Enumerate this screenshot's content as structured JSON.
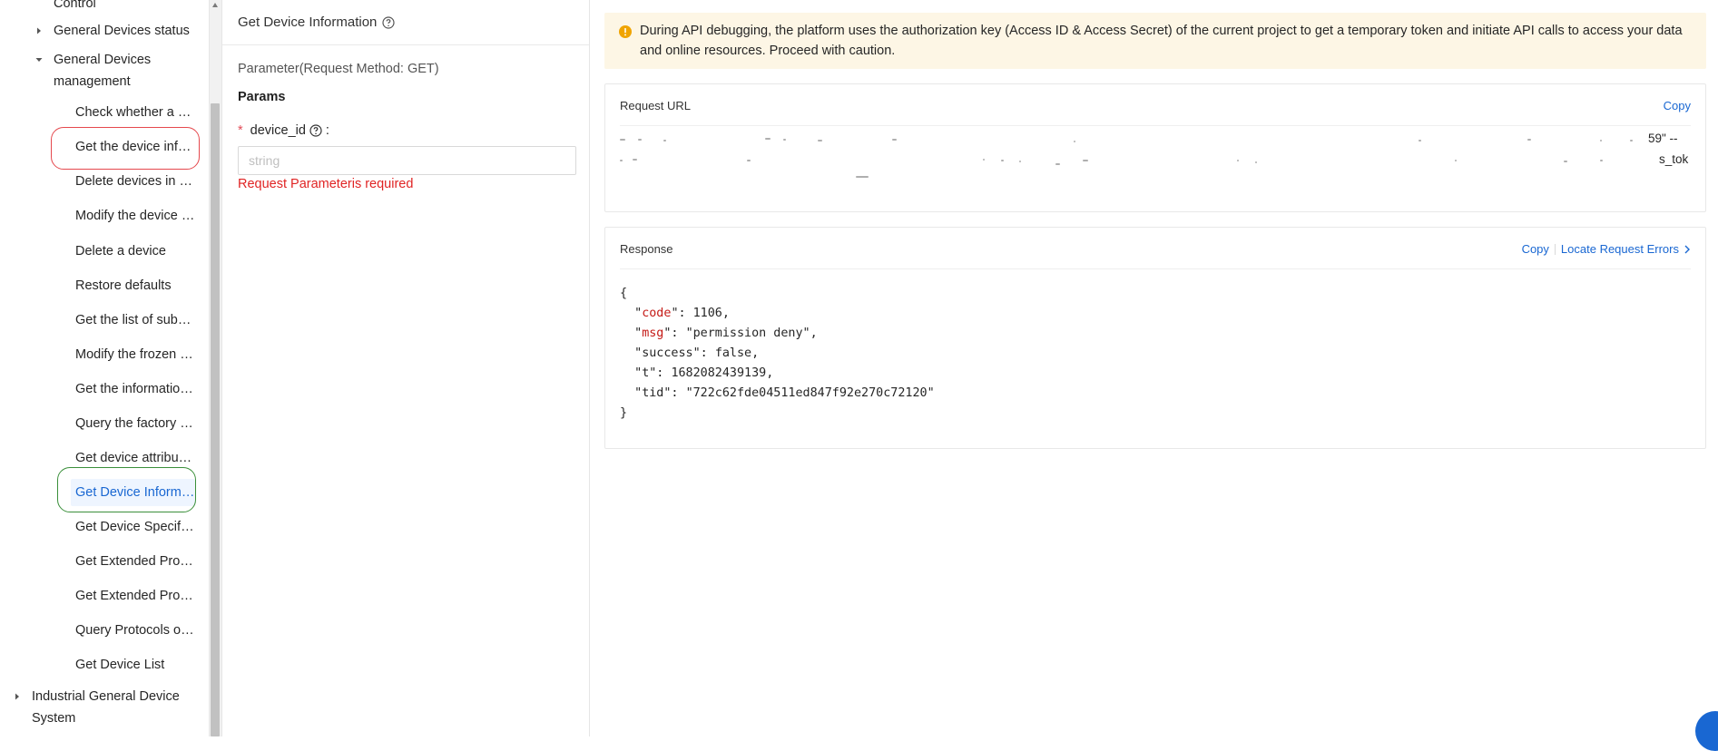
{
  "sidebar": {
    "top_partial_label": "Control",
    "groups": [
      {
        "label": "General Devices status",
        "expanded": false
      },
      {
        "label": "General Devices management",
        "expanded": true
      }
    ],
    "management_items": [
      {
        "label": "Check whether a device exists"
      },
      {
        "label": "Get the device information"
      },
      {
        "label": "Delete devices in batches"
      },
      {
        "label": "Modify the device name"
      },
      {
        "label": "Delete a device"
      },
      {
        "label": "Restore defaults"
      },
      {
        "label": "Get the list of sub-devices"
      },
      {
        "label": "Modify the frozen state"
      },
      {
        "label": "Get the information of devices"
      },
      {
        "label": "Query the factory information"
      },
      {
        "label": "Get device attributes"
      },
      {
        "label": "Get Device Information",
        "active": true
      },
      {
        "label": "Get Device Specifications"
      },
      {
        "label": "Get Extended Properties"
      },
      {
        "label": "Get Extended Properties Value"
      },
      {
        "label": "Query Protocols of Devices"
      },
      {
        "label": "Get Device List"
      }
    ],
    "bottom_group": {
      "label_line1": "Industrial General Device",
      "label_line2": "System",
      "expanded": false
    }
  },
  "middle": {
    "title": "Get Device Information",
    "request_method_caption": "Parameter(Request Method: GET)",
    "params_title": "Params",
    "field": {
      "label": "device_id",
      "colon": ":",
      "placeholder": "string",
      "value": "",
      "error": "Request Parameteris required"
    }
  },
  "right": {
    "notice": "During API debugging, the platform uses the authorization key (Access ID & Access Secret) of the current project to get a temporary token and initiate API calls to access your data and online resources. Proceed with caution.",
    "request_url": {
      "title": "Request URL",
      "copy_label": "Copy",
      "visible_fragments": [
        "59\" --",
        "s_tok"
      ]
    },
    "response": {
      "title": "Response",
      "copy_label": "Copy",
      "locate_label": "Locate Request Errors",
      "json": {
        "code": "1106",
        "msg": "\"permission deny\"",
        "success": "false",
        "t": "1682082439139",
        "tid": "\"722c62fde04511ed847f92e270c72120\""
      }
    }
  },
  "colors": {
    "accent": "#1967d2",
    "error": "#e02424",
    "notice_bg": "#fdf6e5",
    "notice_icon": "#f0a400",
    "json_key": "#c41a16",
    "highlight_red": "#e5484d",
    "highlight_green": "#3a8f3a"
  }
}
